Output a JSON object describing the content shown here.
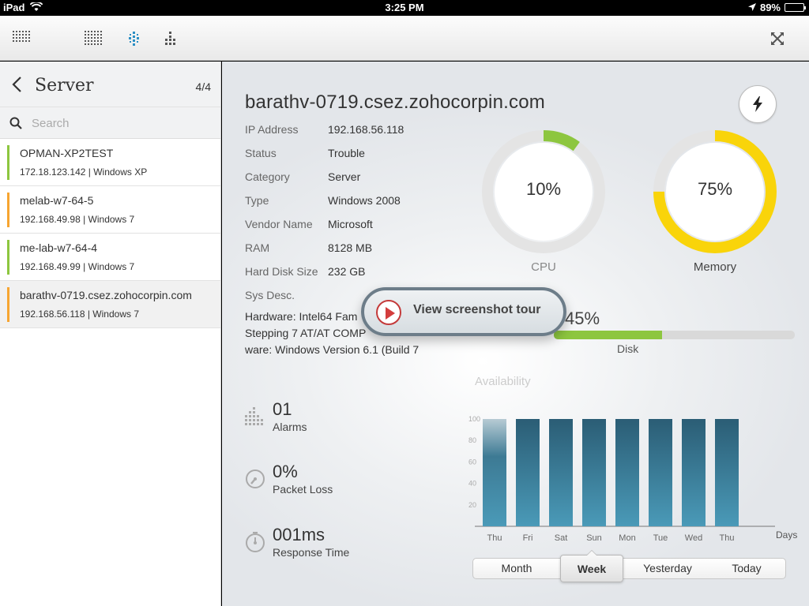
{
  "status_bar": {
    "carrier": "iPad",
    "time": "3:25 PM",
    "battery": "89%"
  },
  "toolbar": {
    "icons": [
      "grid-menu-icon",
      "dashboard-grid-icon",
      "network-map-icon",
      "tree-view-icon",
      "close-fullscreen-icon"
    ]
  },
  "sidebar": {
    "title": "Server",
    "count": "4/4",
    "search_placeholder": "Search",
    "items": [
      {
        "name": "OPMAN-XP2TEST",
        "meta": "172.18.123.142 | Windows XP",
        "status_color": "#8dc63f"
      },
      {
        "name": "melab-w7-64-5",
        "meta": "192.168.49.98 | Windows 7",
        "status_color": "#f7a531"
      },
      {
        "name": "me-lab-w7-64-4",
        "meta": "192.168.49.99 | Windows 7",
        "status_color": "#8dc63f"
      },
      {
        "name": "barathv-0719.csez.zohocorpin.com",
        "meta": "192.168.56.118 | Windows 7",
        "status_color": "#f7a531"
      }
    ]
  },
  "details": {
    "hostname": "barathv-0719.csez.zohocorpin.com",
    "properties": [
      {
        "key": "IP Address",
        "value": "192.168.56.118"
      },
      {
        "key": "Status",
        "value": "Trouble"
      },
      {
        "key": "Category",
        "value": "Server"
      },
      {
        "key": "Type",
        "value": "Windows 2008"
      },
      {
        "key": "Vendor Name",
        "value": "Microsoft"
      },
      {
        "key": "RAM",
        "value": "8128 MB"
      },
      {
        "key": "Hard Disk Size",
        "value": "232 GB"
      },
      {
        "key": "Sys Desc.",
        "value": ""
      }
    ],
    "sys_desc_lines": [
      "Hardware: Intel64 Fam",
      "Stepping 7 AT/AT COMP",
      "ware: Windows Version 6.1 (Build 7"
    ]
  },
  "gauges": {
    "cpu": {
      "label": "CPU",
      "value": 10,
      "display": "10%",
      "color": "#8dc63f"
    },
    "memory": {
      "label": "Memory",
      "value": 75,
      "display": "75%",
      "color": "#f9d40a"
    }
  },
  "disk": {
    "label": "Disk",
    "value": 45,
    "display": "45%",
    "color": "#8dc63f"
  },
  "tour": {
    "label": "View screenshot tour"
  },
  "stats": [
    {
      "value": "01",
      "label": "Alarms",
      "icon": "alarm-grid-icon"
    },
    {
      "value": "0%",
      "label": "Packet Loss",
      "icon": "packet-loss-gauge-icon"
    },
    {
      "value": "001ms",
      "label": "Response Time",
      "icon": "response-time-timer-icon"
    }
  ],
  "availability": {
    "title": "Availability",
    "x_axis_label": "Days"
  },
  "chart_data": {
    "type": "bar",
    "title": "Availability",
    "xlabel": "Days",
    "ylabel": "",
    "categories": [
      "Thu",
      "Fri",
      "Sat",
      "Sun",
      "Mon",
      "Tue",
      "Wed",
      "Thu"
    ],
    "values": [
      100,
      100,
      100,
      100,
      100,
      100,
      100,
      100
    ],
    "yticks": [
      20,
      40,
      60,
      80,
      100
    ],
    "ylim": [
      0,
      100
    ],
    "grid": false,
    "bar_color": "#3a7a93"
  },
  "time_range": {
    "options": [
      "Month",
      "Week",
      "Yesterday",
      "Today"
    ],
    "selected": "Week"
  }
}
